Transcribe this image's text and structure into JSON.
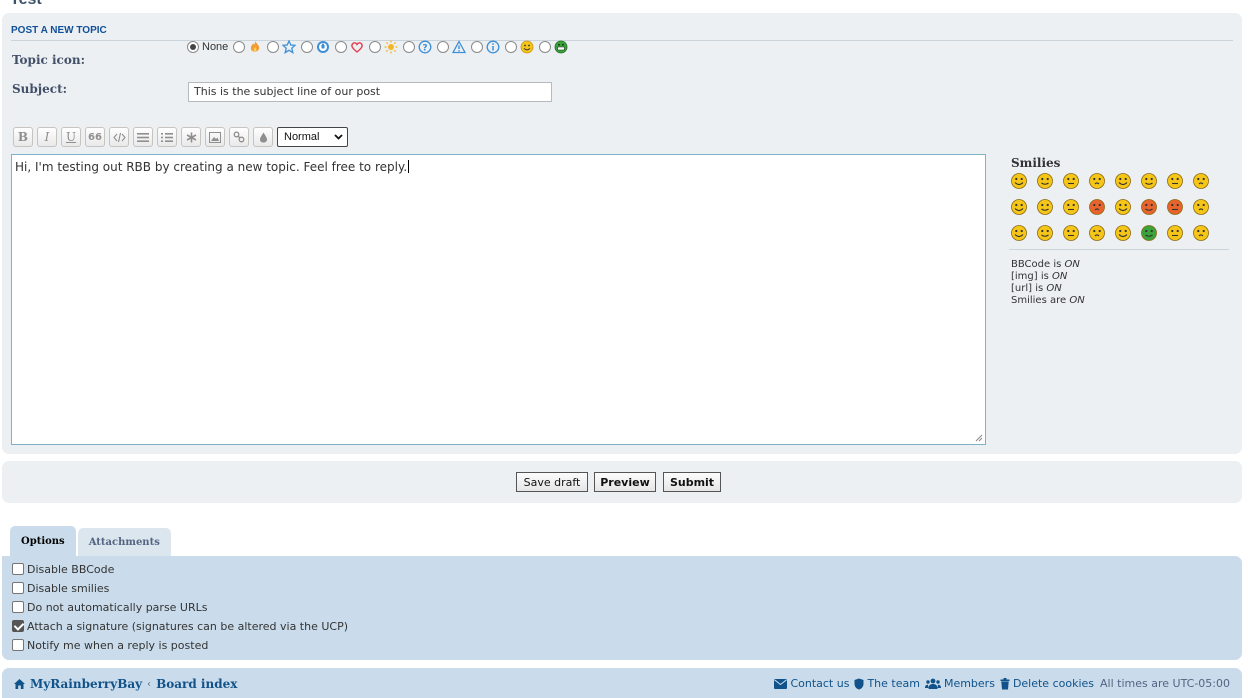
{
  "page": {
    "cut_title": "Test"
  },
  "post_form": {
    "heading": "POST A NEW TOPIC",
    "topic_icon_label": "Topic icon:",
    "topic_icon_none": "None",
    "topic_icons": [
      "fire-icon",
      "star-icon",
      "radioactive-icon",
      "heart-icon",
      "sun-icon",
      "question-icon",
      "warning-icon",
      "info-icon",
      "smiley-icon",
      "grin-icon"
    ],
    "subject_label": "Subject:",
    "subject_value": "This is the subject line of our post",
    "font_size_selected": "Normal",
    "message": "Hi, I'm testing out RBB by creating a new topic. Feel free to reply."
  },
  "toolbar": {
    "bold": "B",
    "italic": "I",
    "underline": "U",
    "quote": "66"
  },
  "smilies": {
    "title": "Smilies",
    "items": [
      {
        "face": "#f5c518",
        "mood": "grin"
      },
      {
        "face": "#f5c518",
        "mood": "happy"
      },
      {
        "face": "#f5c518",
        "mood": "smile"
      },
      {
        "face": "#f5c518",
        "mood": "oo"
      },
      {
        "face": "#f5c518",
        "mood": "shock"
      },
      {
        "face": "#f5c518",
        "mood": "eek"
      },
      {
        "face": "#f5c518",
        "mood": "confused"
      },
      {
        "face": "#f5c518",
        "mood": "cool"
      },
      {
        "face": "#f5c518",
        "mood": "laugh"
      },
      {
        "face": "#f5c518",
        "mood": "mad"
      },
      {
        "face": "#f5c518",
        "mood": "razz"
      },
      {
        "face": "#e8642c",
        "mood": "redface"
      },
      {
        "face": "#f5c518",
        "mood": "cry"
      },
      {
        "face": "#e8642c",
        "mood": "evil"
      },
      {
        "face": "#e8642c",
        "mood": "twisted"
      },
      {
        "face": "#f5c518",
        "mood": "roll"
      },
      {
        "face": "#f5c518",
        "mood": "exclaim"
      },
      {
        "face": "#f5c518",
        "mood": "question"
      },
      {
        "face": "#f5c518",
        "mood": "idea"
      },
      {
        "face": "#f5c518",
        "mood": "arrow"
      },
      {
        "face": "#f5c518",
        "mood": "neutral"
      },
      {
        "face": "#3aa43a",
        "mood": "mrgreen"
      },
      {
        "face": "#f5c518",
        "mood": "geek"
      },
      {
        "face": "#f5c518",
        "mood": "ugeek"
      }
    ],
    "status": [
      {
        "prefix": "BBCode is ",
        "state": "ON"
      },
      {
        "prefix": "[img] is ",
        "state": "ON"
      },
      {
        "prefix": "[url] is ",
        "state": "ON"
      },
      {
        "prefix": "Smilies are ",
        "state": "ON"
      }
    ]
  },
  "actions": {
    "save_draft": "Save draft",
    "preview": "Preview",
    "submit": "Submit"
  },
  "tabs": {
    "options": "Options",
    "attachments": "Attachments"
  },
  "options": [
    {
      "label": "Disable BBCode",
      "checked": false
    },
    {
      "label": "Disable smilies",
      "checked": false
    },
    {
      "label": "Do not automatically parse URLs",
      "checked": false
    },
    {
      "label": "Attach a signature (signatures can be altered via the UCP)",
      "checked": true
    },
    {
      "label": "Notify me when a reply is posted",
      "checked": false
    }
  ],
  "navbar": {
    "site": "MyRainberryBay",
    "board_index": "Board index",
    "contact": "Contact us",
    "team": "The team",
    "members": "Members",
    "delete_cookies": "Delete cookies",
    "timezone": "All times are UTC-05:00"
  },
  "colors": {
    "panel_bg": "#ecf0f3",
    "panel_blue": "#cadceb",
    "link": "#105289",
    "editor_border": "#7eb2c7"
  }
}
